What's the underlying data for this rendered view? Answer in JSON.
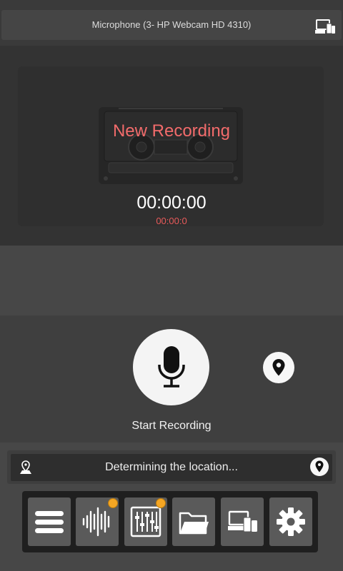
{
  "header": {
    "microphone_source": "Microphone (3- HP Webcam HD 4310)",
    "devices_icon": "devices-icon"
  },
  "display": {
    "title": "New Recording",
    "timer": "00:00:00",
    "timer_detail": "00:00:0",
    "cassette_icon": "cassette-icon"
  },
  "controls": {
    "record_label": "Start Recording",
    "record_icon": "microphone-icon",
    "location_icon": "location-pin-icon"
  },
  "location_bar": {
    "status": "Determining the location...",
    "left_icon": "map-marker-icon",
    "right_icon": "location-pin-icon"
  },
  "toolbar": {
    "items": [
      {
        "icon": "menu-icon",
        "badge": false
      },
      {
        "icon": "waveform-icon",
        "badge": true
      },
      {
        "icon": "mixer-icon",
        "badge": true
      },
      {
        "icon": "folder-icon",
        "badge": false
      },
      {
        "icon": "devices-icon",
        "badge": false
      },
      {
        "icon": "gear-icon",
        "badge": false
      }
    ]
  },
  "colors": {
    "accent_red": "#f26b6b",
    "badge_orange": "#f5a623"
  }
}
